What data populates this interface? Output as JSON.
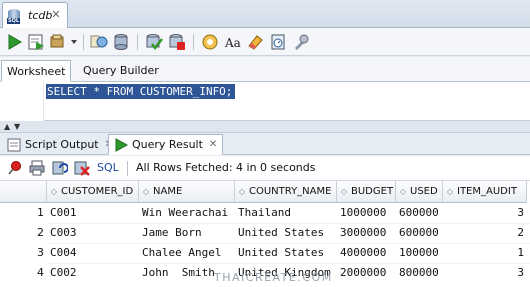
{
  "window": {
    "tab_title": "tcdb"
  },
  "subtabs": [
    "Worksheet",
    "Query Builder"
  ],
  "editor": {
    "sql": "SELECT * FROM CUSTOMER_INFO;"
  },
  "output_tabs": [
    "Script Output",
    "Query Result"
  ],
  "results": {
    "sql_label": "SQL",
    "status": "All Rows Fetched: 4 in 0 seconds",
    "columns": [
      "CUSTOMER_ID",
      "NAME",
      "COUNTRY_NAME",
      "BUDGET",
      "USED",
      "ITEM_AUDIT"
    ],
    "rows": [
      {
        "n": "1",
        "id": "C001",
        "name": "Win Weerachai",
        "country": "Thailand",
        "budget": "1000000",
        "used": "600000",
        "audit": "3"
      },
      {
        "n": "2",
        "id": "C003",
        "name": "Jame Born",
        "country": "United States",
        "budget": "3000000",
        "used": "600000",
        "audit": "2"
      },
      {
        "n": "3",
        "id": "C004",
        "name": "Chalee Angel",
        "country": "United States",
        "budget": "4000000",
        "used": "100000",
        "audit": "1"
      },
      {
        "n": "4",
        "id": "C002",
        "name": "John  Smith",
        "country": "United Kingdom",
        "budget": "2000000",
        "used": "800000",
        "audit": "3"
      }
    ]
  },
  "watermark": "THAICREATE.COM",
  "colors": {
    "selection": "#2e5596",
    "run_green": "#2e9a2e",
    "accent_blue": "#1c4aa0"
  },
  "icons": [
    "run-statement-icon",
    "run-script-icon",
    "commit-icon",
    "rollback-icon",
    "autotrace-icon",
    "explain-plan-icon",
    "clear-icon",
    "history-icon",
    "uppercase-icon",
    "format-icon",
    "tools-icon",
    "pin-icon",
    "print-icon",
    "refresh-icon",
    "delete-icon",
    "database-icon"
  ]
}
